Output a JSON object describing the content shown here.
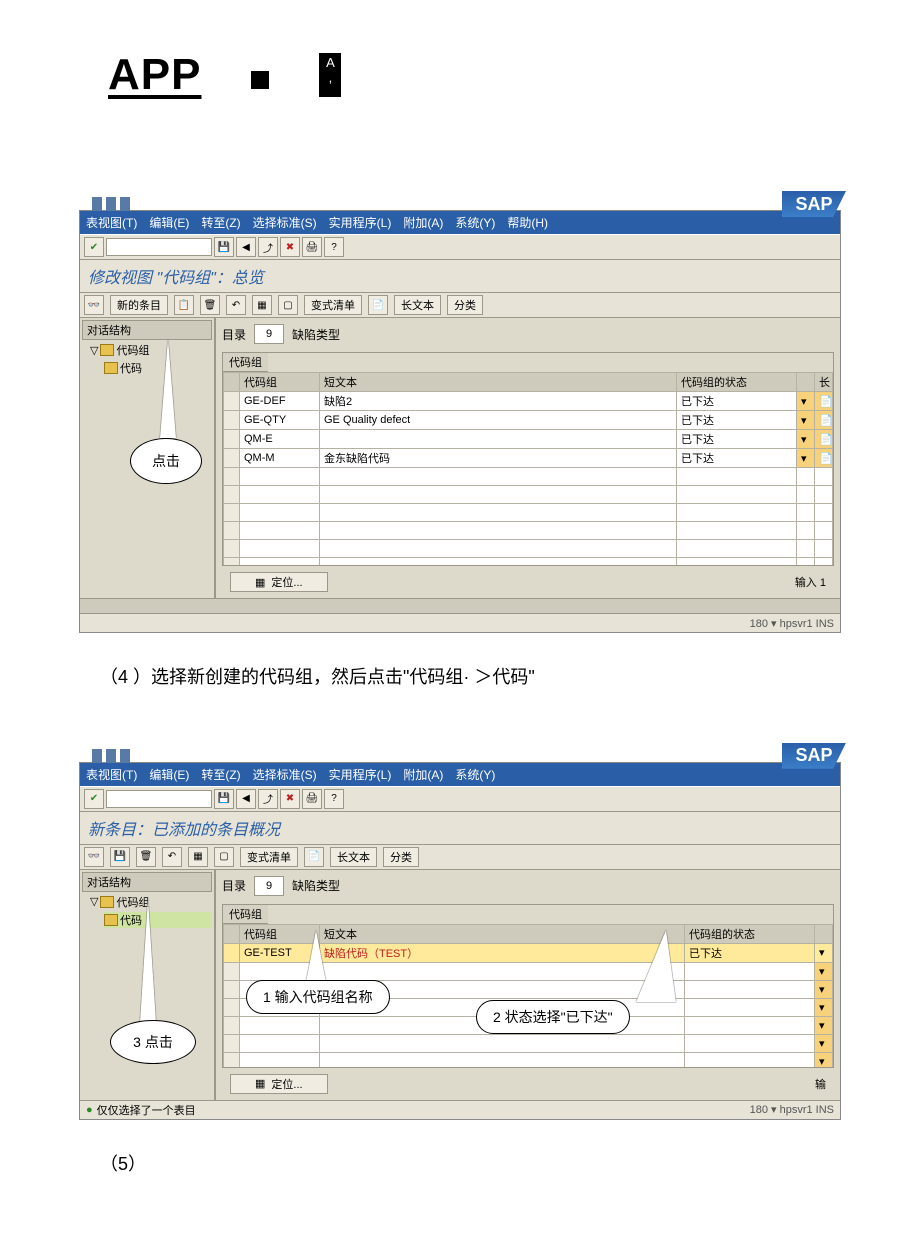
{
  "doc": {
    "title": "APP",
    "pill_text": "A",
    "step4_caption": "（4 ）选择新创建的代码组，然后点击\"代码组· ＞代码\"",
    "step5_caption": "（5）"
  },
  "shot1": {
    "menu": [
      "表视图(T)",
      "编辑(E)",
      "转至(Z)",
      "选择标准(S)",
      "实用程序(L)",
      "附加(A)",
      "系统(Y)",
      "帮助(H)"
    ],
    "view_title": "修改视图 \"代码组\"：总览",
    "toolbar2": {
      "new_entry": "新的条目",
      "varlist": "变式清单",
      "longtext": "长文本",
      "classify": "分类"
    },
    "tree": {
      "title": "对话结构",
      "item1": "代码组",
      "item2": "代码"
    },
    "catalog_label": "目录",
    "catalog_value": "9",
    "catalog_name": "缺陷类型",
    "grid_tab": "代码组",
    "grid_headers": [
      "代码组",
      "短文本",
      "代码组的状态",
      "长"
    ],
    "grid_rows": [
      {
        "code": "GE-DEF",
        "text": "缺陷2",
        "status": "已下达"
      },
      {
        "code": "GE-QTY",
        "text": "GE Quality defect",
        "status": "已下达"
      },
      {
        "code": "QM-E",
        "text": "",
        "status": "已下达"
      },
      {
        "code": "QM-M",
        "text": "金东缺陷代码",
        "status": "已下达"
      }
    ],
    "position_btn": "定位...",
    "input_label": "输入 1",
    "status_right": "180 ▾  hpsvr1  INS",
    "bubble1": "点击"
  },
  "shot2": {
    "menu": [
      "表视图(T)",
      "编辑(E)",
      "转至(Z)",
      "选择标准(S)",
      "实用程序(L)",
      "附加(A)",
      "系统(Y)"
    ],
    "view_title": "新条目：已添加的条目概况",
    "toolbar2": {
      "varlist": "变式清单",
      "longtext": "长文本",
      "classify": "分类"
    },
    "tree": {
      "title": "对话结构",
      "item1": "代码组",
      "item2": "代码"
    },
    "catalog_label": "目录",
    "catalog_value": "9",
    "catalog_name": "缺陷类型",
    "grid_tab": "代码组",
    "grid_headers": [
      "代码组",
      "短文本",
      "代码组的状态"
    ],
    "grid_rows": [
      {
        "code": "GE-TEST",
        "text": "缺陷代码（TEST）",
        "status": "已下达"
      }
    ],
    "position_btn": "定位...",
    "input_label": "输",
    "status_left": "仅仅选择了一个表目",
    "status_right": "180 ▾  hpsvr1  INS",
    "bubble1": "1 输入代码组名称",
    "bubble2": "2 状态选择\"已下达\"",
    "bubble3": "3 点击"
  }
}
